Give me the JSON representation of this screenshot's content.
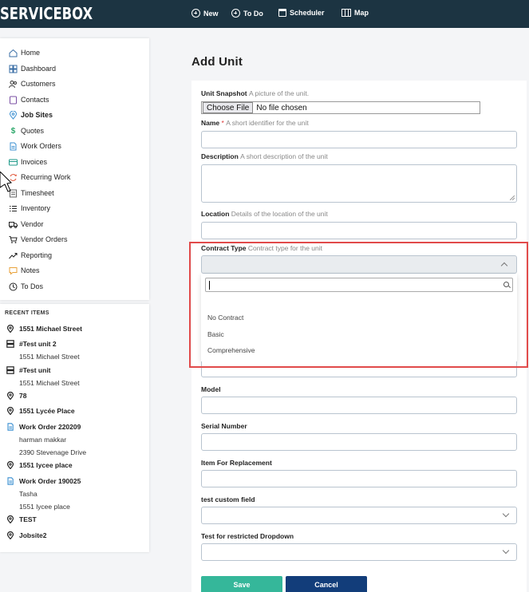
{
  "topbar": {
    "logo": "SERVICEBOX",
    "new_label": "New",
    "todo_label": "To Do",
    "scheduler_label": "Scheduler",
    "map_label": "Map"
  },
  "sidebar": {
    "items": [
      {
        "label": "Home",
        "icon": "home-icon"
      },
      {
        "label": "Dashboard",
        "icon": "dashboard-icon"
      },
      {
        "label": "Customers",
        "icon": "customers-icon"
      },
      {
        "label": "Contacts",
        "icon": "contacts-icon"
      },
      {
        "label": "Job Sites",
        "icon": "location-pin-icon"
      },
      {
        "label": "Quotes",
        "icon": "dollar-icon"
      },
      {
        "label": "Work Orders",
        "icon": "document-icon"
      },
      {
        "label": "Invoices",
        "icon": "invoice-icon"
      },
      {
        "label": "Recurring Work",
        "icon": "recurring-icon"
      },
      {
        "label": "Timesheet",
        "icon": "timesheet-icon"
      },
      {
        "label": "Inventory",
        "icon": "list-icon"
      },
      {
        "label": "Vendor",
        "icon": "truck-icon"
      },
      {
        "label": "Vendor Orders",
        "icon": "cart-icon"
      },
      {
        "label": "Reporting",
        "icon": "chart-icon"
      },
      {
        "label": "Notes",
        "icon": "note-icon"
      },
      {
        "label": "To Dos",
        "icon": "clock-icon"
      }
    ]
  },
  "recent": {
    "title": "RECENT ITEMS",
    "items": [
      {
        "label": "1551 Michael Street",
        "type": "location"
      },
      {
        "label": "#Test unit 2",
        "type": "unit",
        "sub": "1551 Michael Street"
      },
      {
        "label": "#Test unit",
        "type": "unit",
        "sub": "1551 Michael Street"
      },
      {
        "label": "78",
        "type": "location"
      },
      {
        "label": "1551 Lycée Place",
        "type": "location"
      },
      {
        "label": "Work Order 220209",
        "type": "workorder",
        "sub": "harman makkar",
        "sub2": "2390 Stevenage Drive"
      },
      {
        "label": "1551 lycee place",
        "type": "location"
      },
      {
        "label": "Work Order 190025",
        "type": "workorder",
        "sub": "Tasha",
        "sub2": "1551 lycee place"
      },
      {
        "label": "TEST",
        "type": "location"
      },
      {
        "label": "Jobsite2",
        "type": "location"
      }
    ]
  },
  "main": {
    "title": "Add Unit",
    "form": {
      "unit_snapshot": {
        "label": "Unit Snapshot",
        "hint": "A picture of the unit."
      },
      "file_button": "Choose File",
      "file_status": "No file chosen",
      "name": {
        "label": "Name",
        "required": "*",
        "hint": "A short identifier for the unit"
      },
      "description": {
        "label": "Description",
        "hint": "A short description of the unit"
      },
      "location": {
        "label": "Location",
        "hint": "Details of the location of the unit"
      },
      "contract_type": {
        "label": "Contract Type",
        "hint": "Contract type for the unit"
      },
      "contract_options": [
        "No Contract",
        "Basic",
        "Comprehensive"
      ],
      "model": {
        "label": "Model"
      },
      "serial_number": {
        "label": "Serial Number"
      },
      "item_for_replacement": {
        "label": "Item For Replacement"
      },
      "test_custom_field": {
        "label": "test custom field"
      },
      "test_restricted_dropdown": {
        "label": "Test for restricted Dropdown"
      },
      "save_label": "Save",
      "cancel_label": "Cancel"
    }
  },
  "colors": {
    "topbar": "#1c3442",
    "save": "#35b79a",
    "cancel": "#123d7a",
    "highlight": "#e14a4a"
  }
}
